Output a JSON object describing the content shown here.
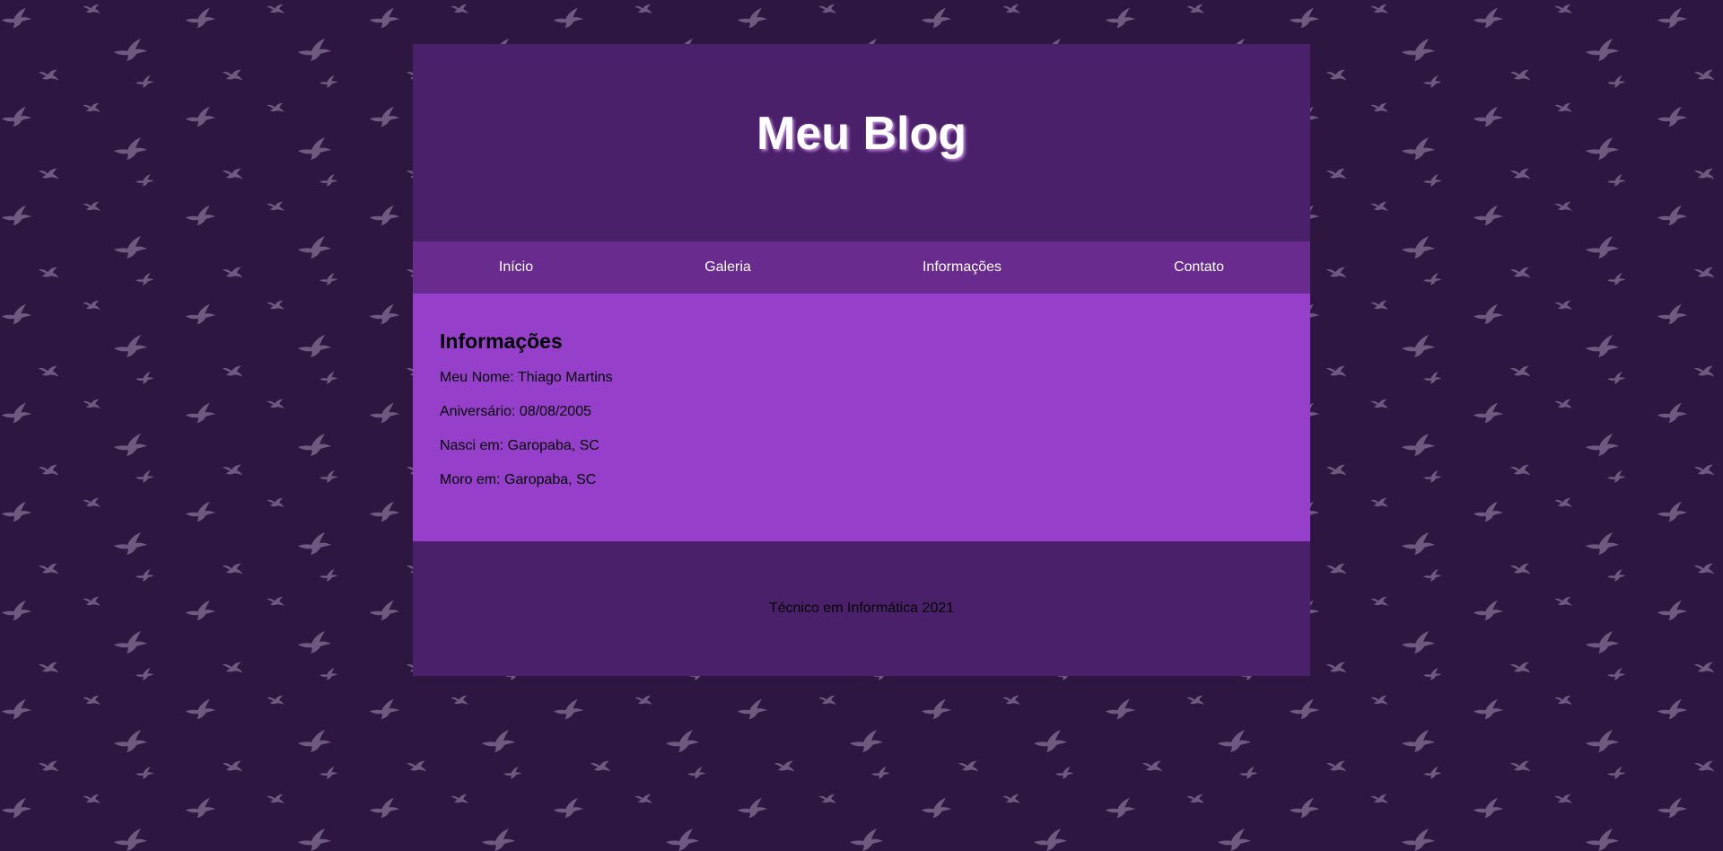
{
  "header": {
    "title": "Meu Blog"
  },
  "nav": {
    "items": [
      {
        "label": "Início"
      },
      {
        "label": "Galeria"
      },
      {
        "label": "Informações"
      },
      {
        "label": "Contato"
      }
    ]
  },
  "content": {
    "heading": "Informações",
    "lines": [
      "Meu Nome: Thiago Martins",
      "Aniversário: 08/08/2005",
      "Nasci em: Garopaba, SC",
      "Moro em: Garopaba, SC"
    ]
  },
  "footer": {
    "text": "Técnico em Informática 2021"
  },
  "colors": {
    "background": "#2d1640",
    "pattern_bird": "#6e5a7e",
    "header": "#4b206a",
    "nav": "#6a2b8f",
    "content": "#953fcb",
    "footer": "#4b206a"
  },
  "icons": {
    "background_pattern": "bird-icon"
  }
}
